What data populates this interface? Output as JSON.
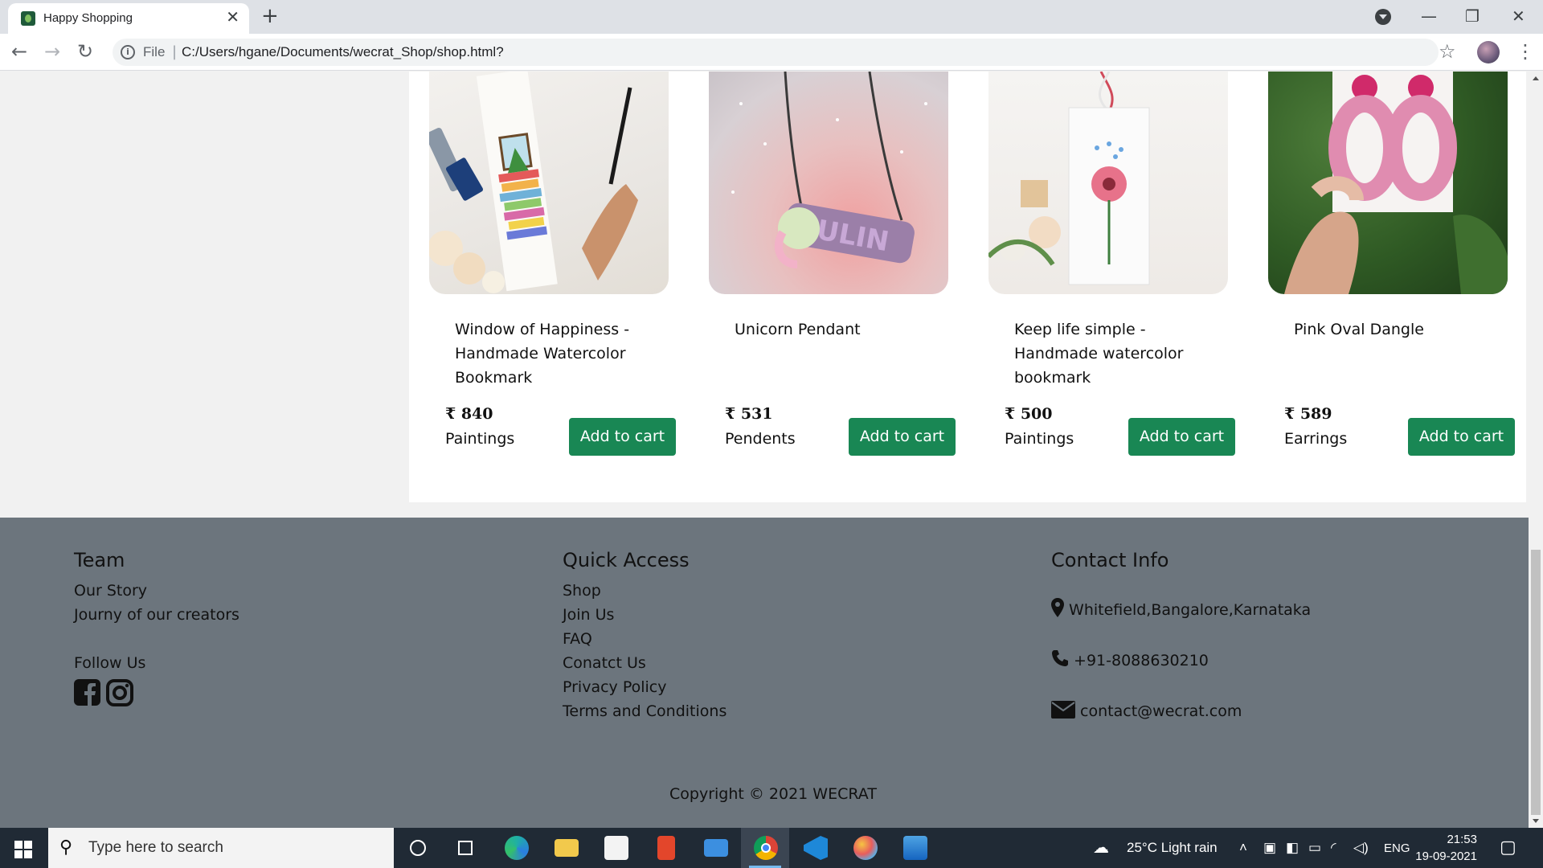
{
  "browser": {
    "tab_title": "Happy Shopping",
    "address_prefix": "File",
    "url": "C:/Users/hgane/Documents/wecrat_Shop/shop.html?"
  },
  "products": [
    {
      "title": "Window of Happiness - Handmade Watercolor Bookmark",
      "price": "₹ 840",
      "category": "Paintings",
      "button": "Add to cart"
    },
    {
      "title": "Unicorn Pendant",
      "price": "₹ 531",
      "category": "Pendents",
      "button": "Add to cart",
      "image_text": "JULIN"
    },
    {
      "title": "Keep life simple - Handmade watercolor bookmark",
      "price": "₹ 500",
      "category": "Paintings",
      "button": "Add to cart"
    },
    {
      "title": "Pink Oval Dangle",
      "price": "₹ 589",
      "category": "Earrings",
      "button": "Add to cart"
    }
  ],
  "footer": {
    "team": {
      "heading": "Team",
      "links": [
        "Our Story",
        "Journy of our creators"
      ],
      "follow_label": "Follow Us"
    },
    "quick_access": {
      "heading": "Quick Access",
      "links": [
        "Shop",
        "Join Us",
        "FAQ",
        "Conatct Us",
        "Privacy Policy",
        "Terms and Conditions"
      ]
    },
    "contact": {
      "heading": "Contact Info",
      "address": "Whitefield,Bangalore,Karnataka",
      "phone": "+91-8088630210",
      "email": "contact@wecrat.com"
    },
    "copyright": "Copyright © 2021 WECRAT"
  },
  "taskbar": {
    "search_placeholder": "Type here to search",
    "weather": "25°C  Light rain",
    "language": "ENG",
    "time": "21:53",
    "date": "19-09-2021"
  },
  "colors": {
    "button_green": "#198754",
    "footer_gray": "#6c757d"
  }
}
